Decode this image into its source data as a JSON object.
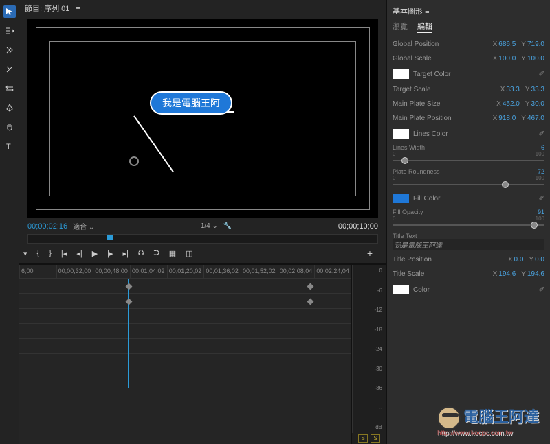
{
  "header": {
    "program_label": "節目: 序列 01",
    "menu_glyph": "≡"
  },
  "callout": {
    "text": "我是電腦王阿"
  },
  "monitor": {
    "tc_current": "00;00;02;16",
    "fit_label": "適合",
    "quality": "1/4",
    "tc_duration": "00;00;10;00"
  },
  "timeline": {
    "ticks": [
      "6;00",
      "00;00;32;00",
      "00;00;48;00",
      "00;01;04;02",
      "00;01;20;02",
      "00;01;36;02",
      "00;01;52;02",
      "00;02;08;04",
      "00;02;24;04"
    ]
  },
  "audio": {
    "marks": [
      "0",
      "-6",
      "-12",
      "-18",
      "-24",
      "-30",
      "-36",
      "--",
      "dB"
    ],
    "solo": "S"
  },
  "panel": {
    "title": "基本圖形",
    "tab_browse": "瀏覽",
    "tab_edit": "編輯",
    "global_position": {
      "label": "Global Position",
      "x": "686.5",
      "y": "719.0"
    },
    "global_scale": {
      "label": "Global Scale",
      "x": "100.0",
      "y": "100.0"
    },
    "target_color": {
      "label": "Target Color"
    },
    "target_scale": {
      "label": "Target Scale",
      "x": "33.3",
      "y": "33.3"
    },
    "main_plate_size": {
      "label": "Main Plate Size",
      "x": "452.0",
      "y": "30.0"
    },
    "main_plate_position": {
      "label": "Main Plate Position",
      "x": "918.0",
      "y": "467.0"
    },
    "lines_color": {
      "label": "Lines Color"
    },
    "lines_width": {
      "label": "Lines Width",
      "value": "6",
      "min": "0",
      "max": "100"
    },
    "plate_roundness": {
      "label": "Plate Roundness",
      "value": "72",
      "min": "0",
      "max": "100"
    },
    "fill_color": {
      "label": "Fill Color"
    },
    "fill_opacity": {
      "label": "Fill Opacity",
      "value": "91",
      "min": "0",
      "max": "100"
    },
    "title_text": {
      "label": "Title Text",
      "value": "我是電腦王阿達"
    },
    "title_position": {
      "label": "Title Position",
      "x": "0.0",
      "y": "0.0"
    },
    "title_scale": {
      "label": "Title Scale",
      "x": "194.6",
      "y": "194.6"
    },
    "color": {
      "label": "Color"
    }
  },
  "labels": {
    "x": "X",
    "y": "Y",
    "chevron": "⌄",
    "wrench": "🔧",
    "eyedrop": "✐",
    "plus": "+"
  },
  "watermark": {
    "text": "電腦王阿達",
    "url": "http://www.kocpc.com.tw"
  }
}
